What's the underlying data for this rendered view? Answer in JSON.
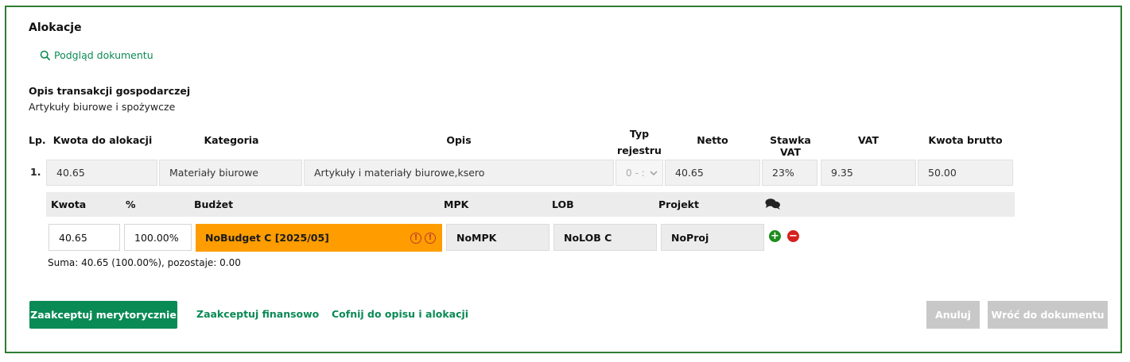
{
  "title": "Alokacje",
  "preview_link": "Podgląd dokumentu",
  "description": {
    "label": "Opis transakcji gospodarczej",
    "value": "Artykuły biurowe i spożywcze"
  },
  "table": {
    "headers": {
      "lp": "Lp.",
      "amount": "Kwota do alokacji",
      "category": "Kategoria",
      "desc": "Opis",
      "register_type_line1": "Typ",
      "register_type_line2": "rejestru",
      "net": "Netto",
      "vat_rate": "Stawka VAT",
      "vat": "VAT",
      "gross": "Kwota brutto"
    },
    "row": {
      "lp": "1.",
      "amount": "40.65",
      "category": "Materiały biurowe",
      "desc": "Artykuły i materiały biurowe,ksero",
      "register_type": "0 - :",
      "net": "40.65",
      "vat_rate": "23%",
      "vat": "9.35",
      "gross": "50.00"
    }
  },
  "allocation": {
    "headers": {
      "amount": "Kwota",
      "percent": "%",
      "budget": "Budżet",
      "mpk": "MPK",
      "lob": "LOB",
      "project": "Projekt"
    },
    "row": {
      "amount": "40.65",
      "percent": "100.00%",
      "budget": "NoBudget C [2025/05]",
      "mpk": "NoMPK",
      "lob": "NoLOB C",
      "project": "NoProj"
    },
    "sum": "Suma: 40.65 (100.00%), pozostaje: 0.00"
  },
  "actions": {
    "accept_substantive": "Zaakceptuj merytorycznie",
    "accept_financial": "Zaakceptuj finansowo",
    "revert": "Cofnij do opisu i alokacji",
    "cancel": "Anuluj",
    "back": "Wróć do dokumentu"
  },
  "colors": {
    "primary": "#0a8a55",
    "frame": "#2e7d32",
    "budget_warning": "#ff9d00",
    "add": "#1e8c1e",
    "remove": "#d62020",
    "gray_button": "#c8c8c8"
  },
  "icons": {
    "preview": "search-icon",
    "comments": "comments-icon",
    "warning": "warning-circle-icon",
    "add": "plus-circle-icon",
    "remove": "minus-circle-icon",
    "select": "chevron-down-icon"
  }
}
